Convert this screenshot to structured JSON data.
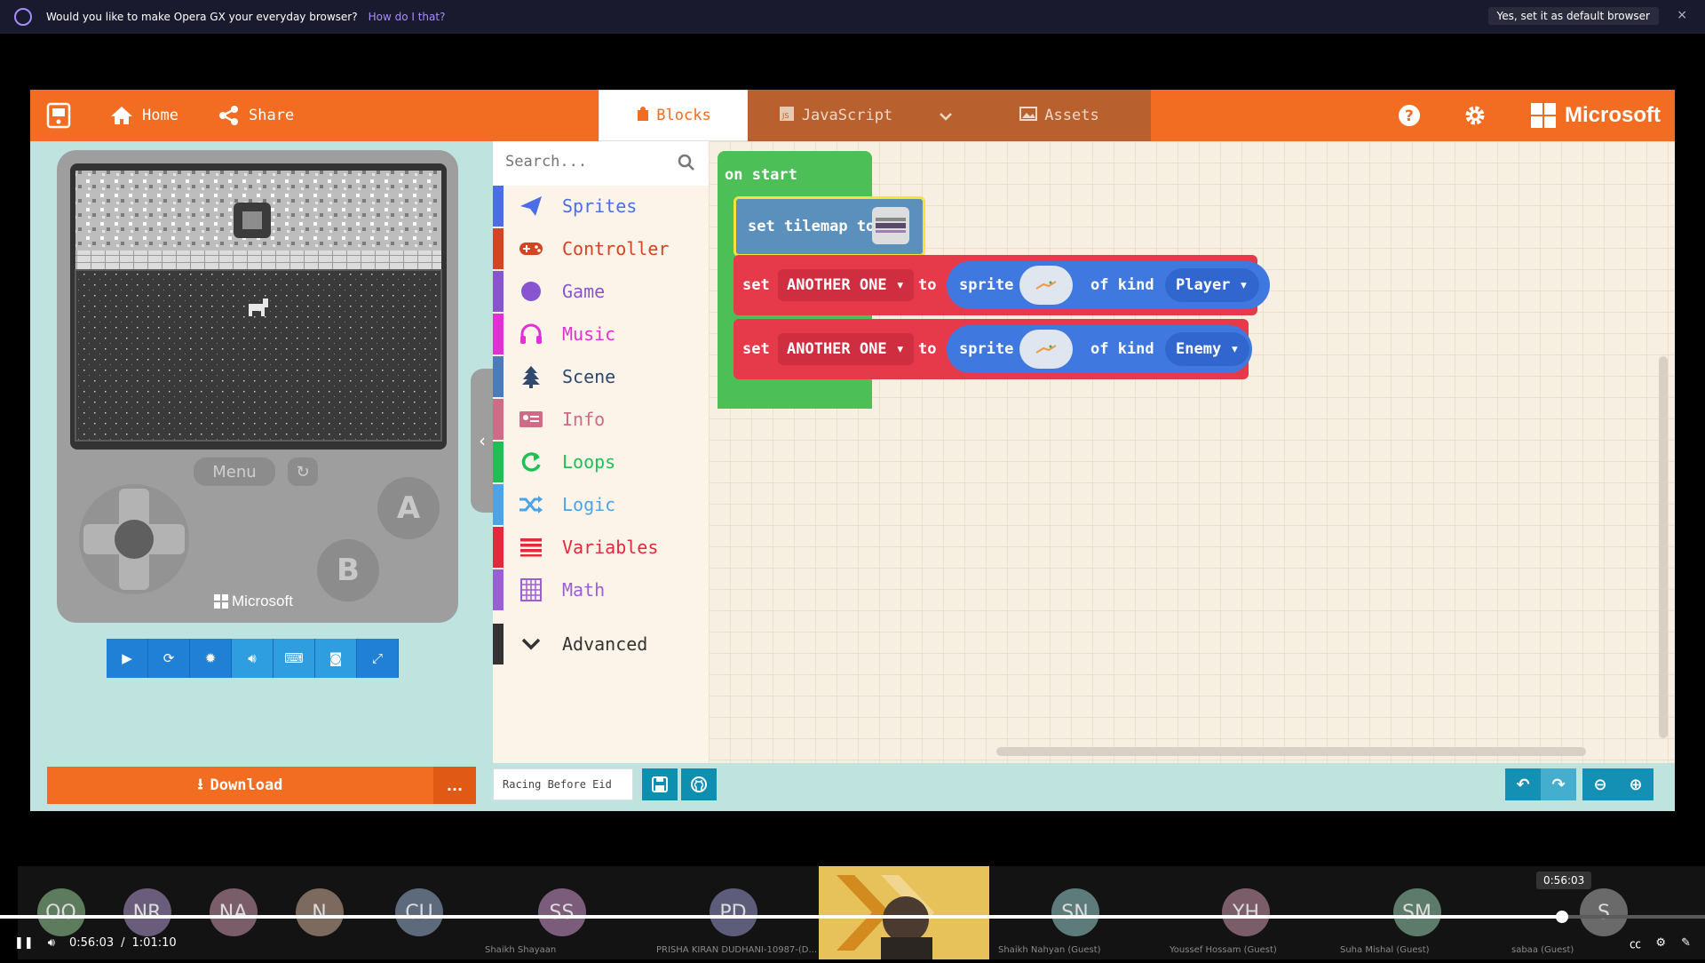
{
  "banner": {
    "message": "Would you like to make Opera GX your everyday browser?",
    "how_link": "How do I that?",
    "default_button": "Yes, set it as default browser",
    "close": "×"
  },
  "topbar": {
    "home": "Home",
    "share": "Share",
    "tab_blocks": "Blocks",
    "tab_javascript": "JavaScript",
    "tab_assets": "Assets",
    "brand": "Microsoft"
  },
  "simulator": {
    "menu_label": "Menu",
    "button_a": "A",
    "button_b": "B",
    "brand": "Microsoft",
    "controls": [
      "play-icon",
      "restart-icon",
      "debug-icon",
      "sound-icon",
      "keyboard-icon",
      "screenshot-icon",
      "fullscreen-icon"
    ]
  },
  "download": {
    "label": "Download",
    "more": "..."
  },
  "toolbox": {
    "search_placeholder": "Search...",
    "categories": [
      {
        "label": "Sprites",
        "color": "#4b6ee8",
        "icon": "paper-plane-icon"
      },
      {
        "label": "Controller",
        "color": "#d54322",
        "icon": "gamepad-icon"
      },
      {
        "label": "Game",
        "color": "#8854d0",
        "icon": "circle-icon"
      },
      {
        "label": "Music",
        "color": "#e52fd6",
        "icon": "headphones-icon"
      },
      {
        "label": "Scene",
        "color": "#4b7bbe",
        "icon": "tree-icon"
      },
      {
        "label": "Info",
        "color": "#cf6a87",
        "icon": "id-card-icon"
      },
      {
        "label": "Loops",
        "color": "#20bf55",
        "icon": "loop-icon"
      },
      {
        "label": "Logic",
        "color": "#4ba3ea",
        "icon": "shuffle-icon"
      },
      {
        "label": "Variables",
        "color": "#e5283c",
        "icon": "list-icon"
      },
      {
        "label": "Math",
        "color": "#9c5ed7",
        "icon": "calculator-icon"
      }
    ],
    "advanced": "Advanced"
  },
  "workspace": {
    "on_start": "on start",
    "set_tilemap": "set tilemap to",
    "set_blocks": [
      {
        "set": "set",
        "variable": "ANOTHER ONE",
        "to": "to",
        "sprite": "sprite",
        "of_kind": "of kind",
        "kind": "Player"
      },
      {
        "set": "set",
        "variable": "ANOTHER ONE",
        "to": "to",
        "sprite": "sprite",
        "of_kind": "of kind",
        "kind": "Enemy"
      }
    ]
  },
  "project": {
    "name": "Racing Before Eid"
  },
  "meeting": {
    "participants": [
      {
        "initials": "OO",
        "name": "",
        "color": "#6b8e6b"
      },
      {
        "initials": "NR",
        "name": "",
        "color": "#7a6b8e"
      },
      {
        "initials": "NA",
        "name": "",
        "color": "#8e6b7a"
      },
      {
        "initials": "N",
        "name": "",
        "color": "#8e7a6b"
      },
      {
        "initials": "CU",
        "name": "",
        "color": "#6b7a8e"
      },
      {
        "initials": "SS",
        "name": "Shaikh Shayaan",
        "color": "#8e6b8e"
      },
      {
        "initials": "PD",
        "name": "PRISHA KIRAN DUDHANI-10987-(D...",
        "color": "#6b6b8e"
      },
      {
        "initials": "",
        "name": "",
        "color": "#000000"
      },
      {
        "initials": "SN",
        "name": "Shaikh Nahyan (Guest)",
        "color": "#6b8e8e"
      },
      {
        "initials": "YH",
        "name": "Youssef Hossam (Guest)",
        "color": "#8e6b7a"
      },
      {
        "initials": "SM",
        "name": "Suha Mishal (Guest)",
        "color": "#6b8e7a"
      },
      {
        "initials": "S",
        "name": "sabaa (Guest)",
        "color": "#7a7a7a"
      }
    ]
  },
  "player": {
    "current_time": "0:56:03",
    "separator": "/",
    "total_time": "1:01:10",
    "tooltip_time": "0:56:03",
    "progress": 0.916
  }
}
